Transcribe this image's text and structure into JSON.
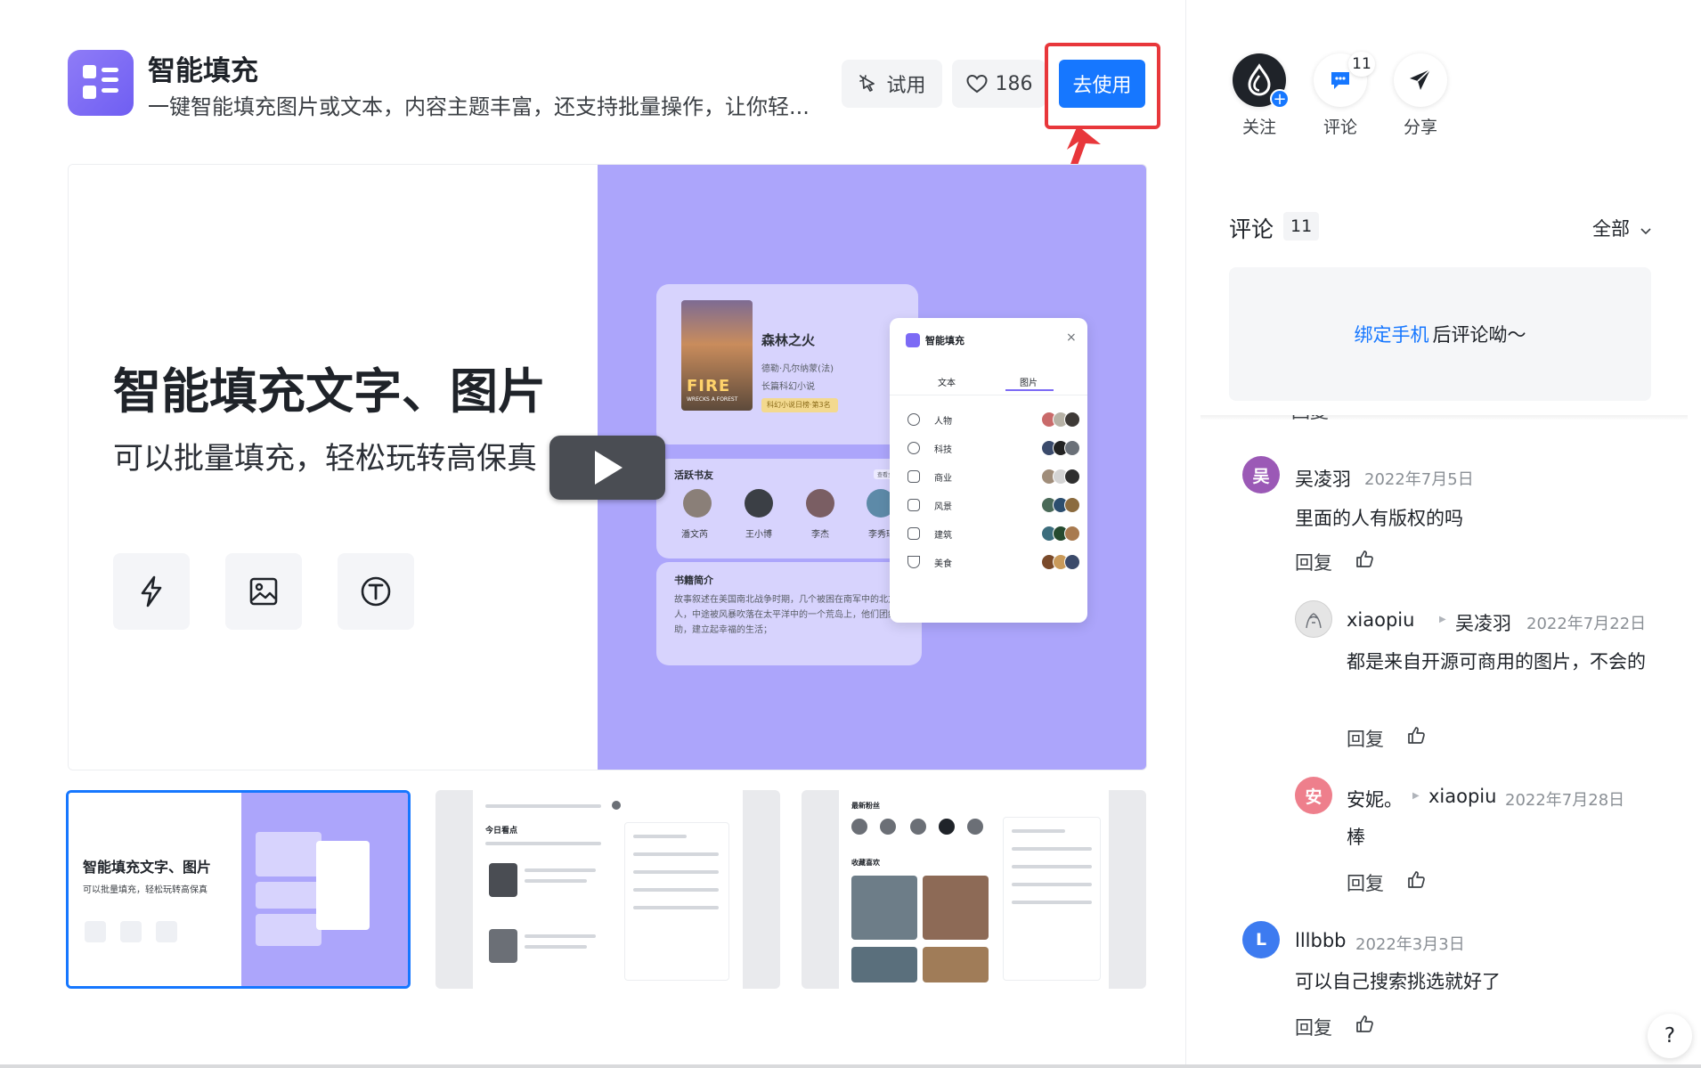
{
  "app": {
    "title": "智能填充",
    "description": "一键智能填充图片或文本，内容主题丰富，还支持批量操作，让你轻..."
  },
  "toolbar": {
    "try_label": "试用",
    "like_count": "186",
    "use_label": "去使用"
  },
  "hero": {
    "headline": "智能填充文字、图片",
    "subline": "可以批量填充，轻松玩转高保真",
    "book_card": {
      "title": "森林之火",
      "author": "德勒·凡尔纳蒙(法)",
      "genre": "长篇科幻小说",
      "tag": "科幻小说日榜·第3名",
      "cover_title": "FIRE",
      "cover_subtitle": "WRECKS A FOREST"
    },
    "active_readers": {
      "title": "活跃书友",
      "badge": "查看全部",
      "names": [
        "潘文芮",
        "王小博",
        "李杰",
        "李秀瑶"
      ]
    },
    "intro_card": {
      "title": "书籍简介",
      "text": "故事叙述在美国南北战争时期，几个被困在南军中的北方人，中途被风暴吹落在太平洋中的一个荒岛上，他们团结互助，建立起幸福的生活；"
    },
    "panel": {
      "title": "智能填充",
      "close": "×",
      "tabs": [
        "文本",
        "图片"
      ],
      "rows": [
        "人物",
        "科技",
        "商业",
        "风景",
        "建筑",
        "美食"
      ]
    }
  },
  "thumbnails": {
    "t1_title": "智能填充文字、图片",
    "t1_sub": "可以批量填充，轻松玩转高保真",
    "t2_section": "今日看点",
    "t3_section_top": "最新粉丝",
    "t3_section_mid": "收藏喜欢"
  },
  "actions": {
    "follow": "关注",
    "comment": "评论",
    "share": "分享",
    "comment_badge": "11"
  },
  "comments": {
    "header": "评论",
    "count": "11",
    "filter": "全部",
    "bind_link": "绑定手机",
    "bind_text": "后评论呦～",
    "truncated_reply": "回复",
    "items": [
      {
        "avatar": "吴",
        "name": "吴凌羽",
        "date": "2022年7月5日",
        "text": "里面的人有版权的吗",
        "reply": "回复"
      },
      {
        "name": "xiaopiu",
        "to": "吴凌羽",
        "date": "2022年7月22日",
        "text": "都是来自开源可商用的图片，不会的",
        "reply": "回复"
      },
      {
        "avatar": "安",
        "name": "安妮。",
        "to": "xiaopiu",
        "date": "2022年7月28日",
        "text": "棒",
        "reply": "回复"
      },
      {
        "avatar": "L",
        "name": "lllbbb",
        "date": "2022年3月3日",
        "text": "可以自己搜索挑选就好了",
        "reply": "回复"
      }
    ]
  },
  "help": "?",
  "colors": {
    "accent": "#1677ff",
    "hero_purple": "#aca5fb",
    "logo_purple": "#7c6af5",
    "highlight_red": "#e8373b"
  }
}
